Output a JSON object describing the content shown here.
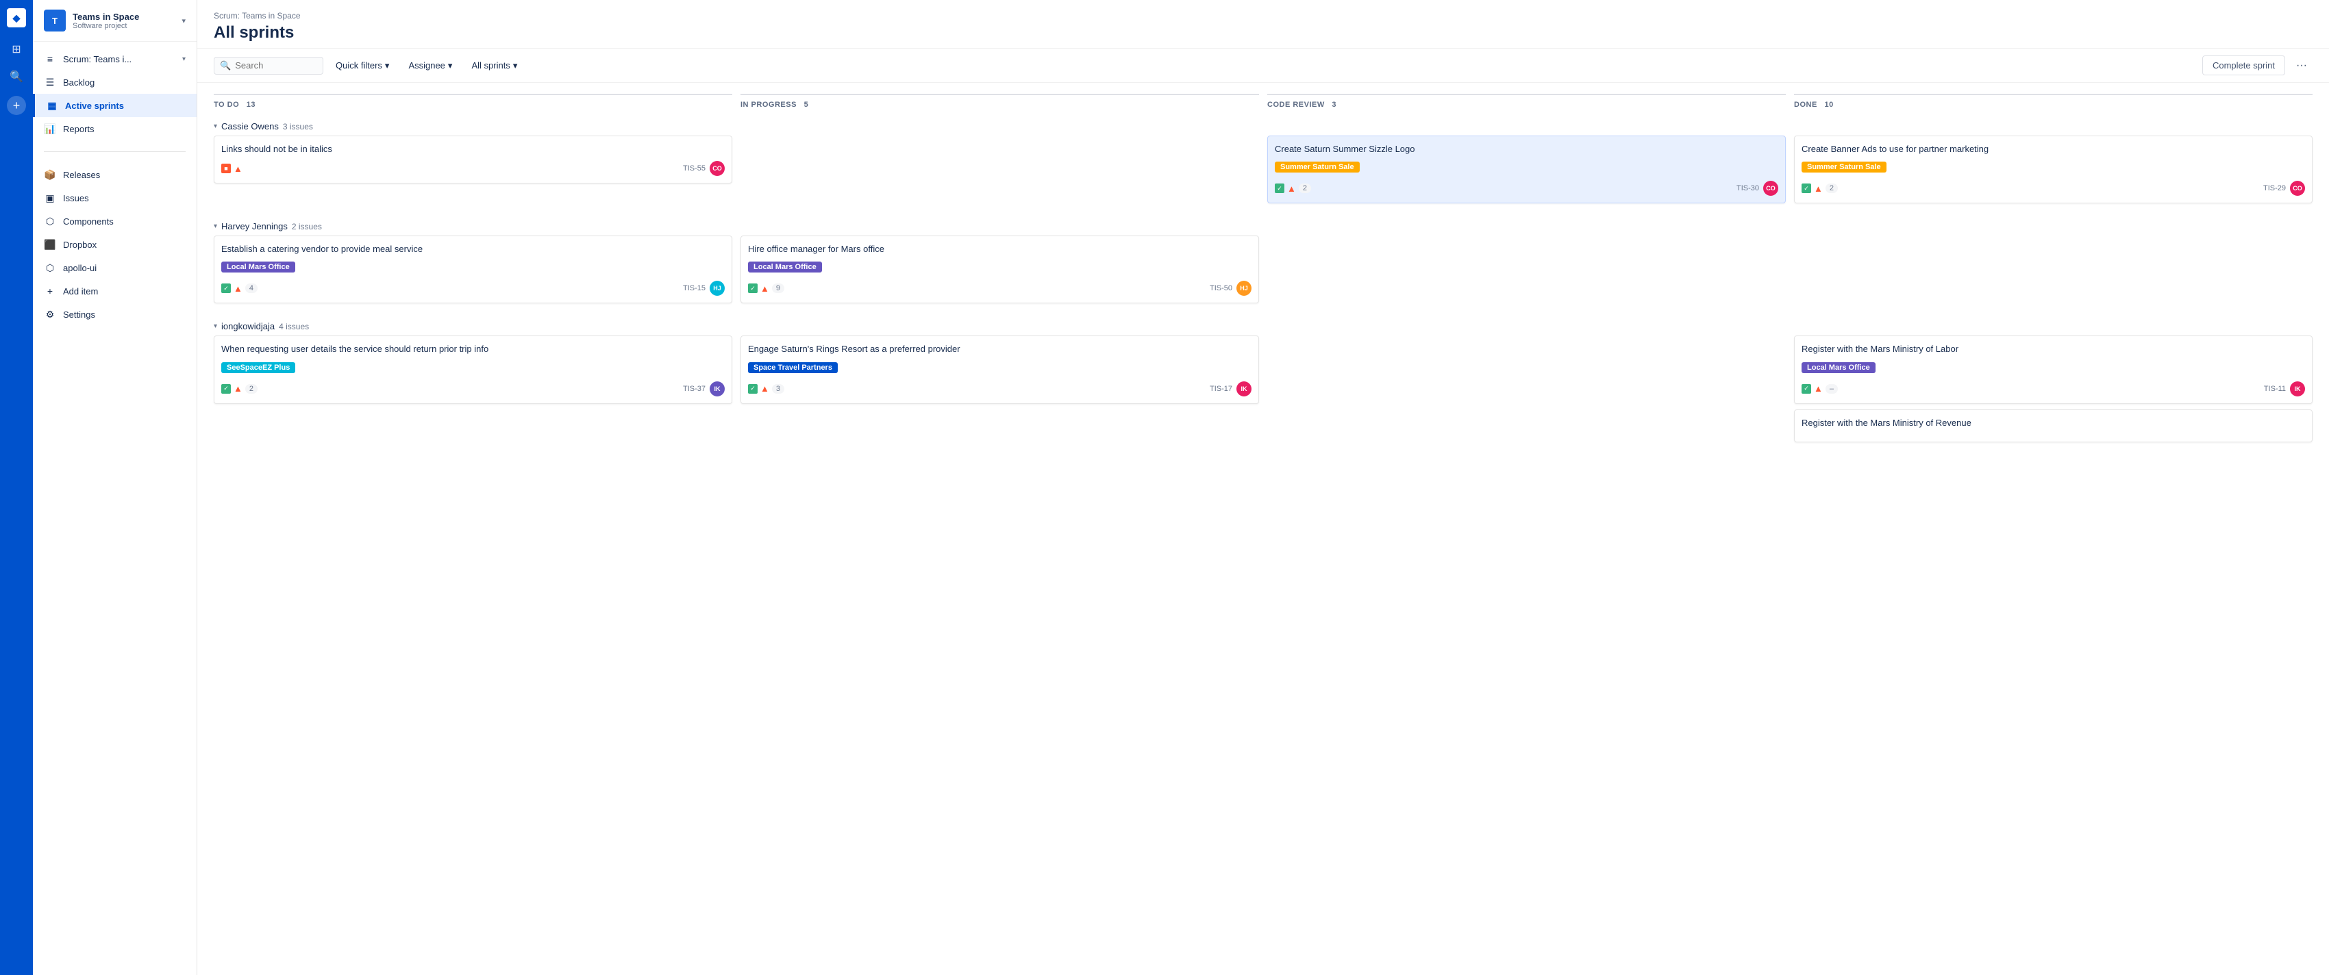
{
  "nav_rail": {
    "logo": "◆",
    "icons": [
      "⊞",
      "🔍",
      "+"
    ]
  },
  "sidebar": {
    "project_name": "Teams in Space",
    "project_sub": "Software project",
    "items": [
      {
        "id": "scrum",
        "label": "Scrum: Teams i...",
        "icon": "≡",
        "active": false,
        "has_arrow": true
      },
      {
        "id": "backlog",
        "label": "Backlog",
        "icon": "☰",
        "active": false
      },
      {
        "id": "active-sprints",
        "label": "Active sprints",
        "icon": "▦",
        "active": true
      },
      {
        "id": "reports",
        "label": "Reports",
        "icon": "📊",
        "active": false
      }
    ],
    "secondary_items": [
      {
        "id": "releases",
        "label": "Releases",
        "icon": "📦"
      },
      {
        "id": "issues",
        "label": "Issues",
        "icon": "▣"
      },
      {
        "id": "components",
        "label": "Components",
        "icon": "⬡"
      },
      {
        "id": "dropbox",
        "label": "Dropbox",
        "icon": "⬛"
      },
      {
        "id": "apollo-ui",
        "label": "apollo-ui",
        "icon": "⬡"
      },
      {
        "id": "add-item",
        "label": "Add item",
        "icon": "+"
      },
      {
        "id": "settings",
        "label": "Settings",
        "icon": "⚙"
      }
    ]
  },
  "header": {
    "breadcrumb": "Scrum: Teams in Space",
    "title": "All sprints"
  },
  "toolbar": {
    "search_placeholder": "Search",
    "quick_filters_label": "Quick filters",
    "assignee_label": "Assignee",
    "all_sprints_label": "All sprints",
    "complete_sprint_label": "Complete sprint",
    "more_label": "···"
  },
  "columns": [
    {
      "id": "todo",
      "label": "TO DO",
      "count": 13
    },
    {
      "id": "inprogress",
      "label": "IN PROGRESS",
      "count": 5
    },
    {
      "id": "codereview",
      "label": "CODE REVIEW",
      "count": 3
    },
    {
      "id": "done",
      "label": "DONE",
      "count": 10
    }
  ],
  "groups": [
    {
      "id": "cassie-owens",
      "name": "Cassie Owens",
      "issues_count": "3 issues",
      "cards": {
        "todo": [
          {
            "title": "Links should not be in italics",
            "tag": null,
            "type": "bug",
            "priority": "high",
            "points": null,
            "ticket": "TIS-55",
            "avatar_color": "#e91e63",
            "avatar_initials": "CO"
          }
        ],
        "inprogress": [],
        "codereview": [
          {
            "title": "Create Saturn Summer Sizzle Logo",
            "tag": "Summer Saturn Sale",
            "tag_style": "yellow",
            "type": "story",
            "priority": "high",
            "points": 2,
            "ticket": "TIS-30",
            "avatar_color": "#e91e63",
            "avatar_initials": "CO",
            "highlighted": true
          }
        ],
        "done": [
          {
            "title": "Create Banner Ads to use for partner marketing",
            "tag": "Summer Saturn Sale",
            "tag_style": "yellow",
            "type": "story",
            "priority": "high",
            "points": 2,
            "ticket": "TIS-29",
            "avatar_color": "#e91e63",
            "avatar_initials": "CO"
          }
        ]
      }
    },
    {
      "id": "harvey-jennings",
      "name": "Harvey Jennings",
      "issues_count": "2 issues",
      "cards": {
        "todo": [
          {
            "title": "Establish a catering vendor to provide meal service",
            "tag": "Local Mars Office",
            "tag_style": "purple",
            "type": "story",
            "priority": "high",
            "points": 4,
            "ticket": "TIS-15",
            "avatar_color": "#00b8d9",
            "avatar_initials": "HJ"
          }
        ],
        "inprogress": [
          {
            "title": "Hire office manager for Mars office",
            "tag": "Local Mars Office",
            "tag_style": "purple",
            "type": "story",
            "priority": "high",
            "points": 9,
            "ticket": "TIS-50",
            "avatar_color": "#ff991f",
            "avatar_initials": "HJ"
          }
        ],
        "codereview": [],
        "done": []
      }
    },
    {
      "id": "iongkowidjaja",
      "name": "iongkowidjaja",
      "issues_count": "4 issues",
      "cards": {
        "todo": [
          {
            "title": "When requesting user details the service should return prior trip info",
            "tag": "SeeSpaceEZ Plus",
            "tag_style": "teal",
            "type": "story",
            "priority": "high",
            "points": 2,
            "ticket": "TIS-37",
            "avatar_color": "#6554c0",
            "avatar_initials": "IK"
          }
        ],
        "inprogress": [
          {
            "title": "Engage Saturn's Rings Resort as a preferred provider",
            "tag": "Space Travel Partners",
            "tag_style": "blue",
            "type": "story",
            "priority": "high",
            "points": 3,
            "ticket": "TIS-17",
            "avatar_color": "#e91e63",
            "avatar_initials": "IK"
          }
        ],
        "codereview": [],
        "done": [
          {
            "title": "Register with the Mars Ministry of Labor",
            "tag": "Local Mars Office",
            "tag_style": "purple",
            "type": "story",
            "priority": "high",
            "points": null,
            "ticket": "TIS-11",
            "avatar_color": "#e91e63",
            "avatar_initials": "IK",
            "dash": true
          },
          {
            "title": "Register with the Mars Ministry of Revenue",
            "tag": null,
            "type": "story",
            "priority": "high",
            "points": null,
            "ticket": "",
            "avatar_color": "#aaa",
            "avatar_initials": ""
          }
        ]
      }
    }
  ]
}
